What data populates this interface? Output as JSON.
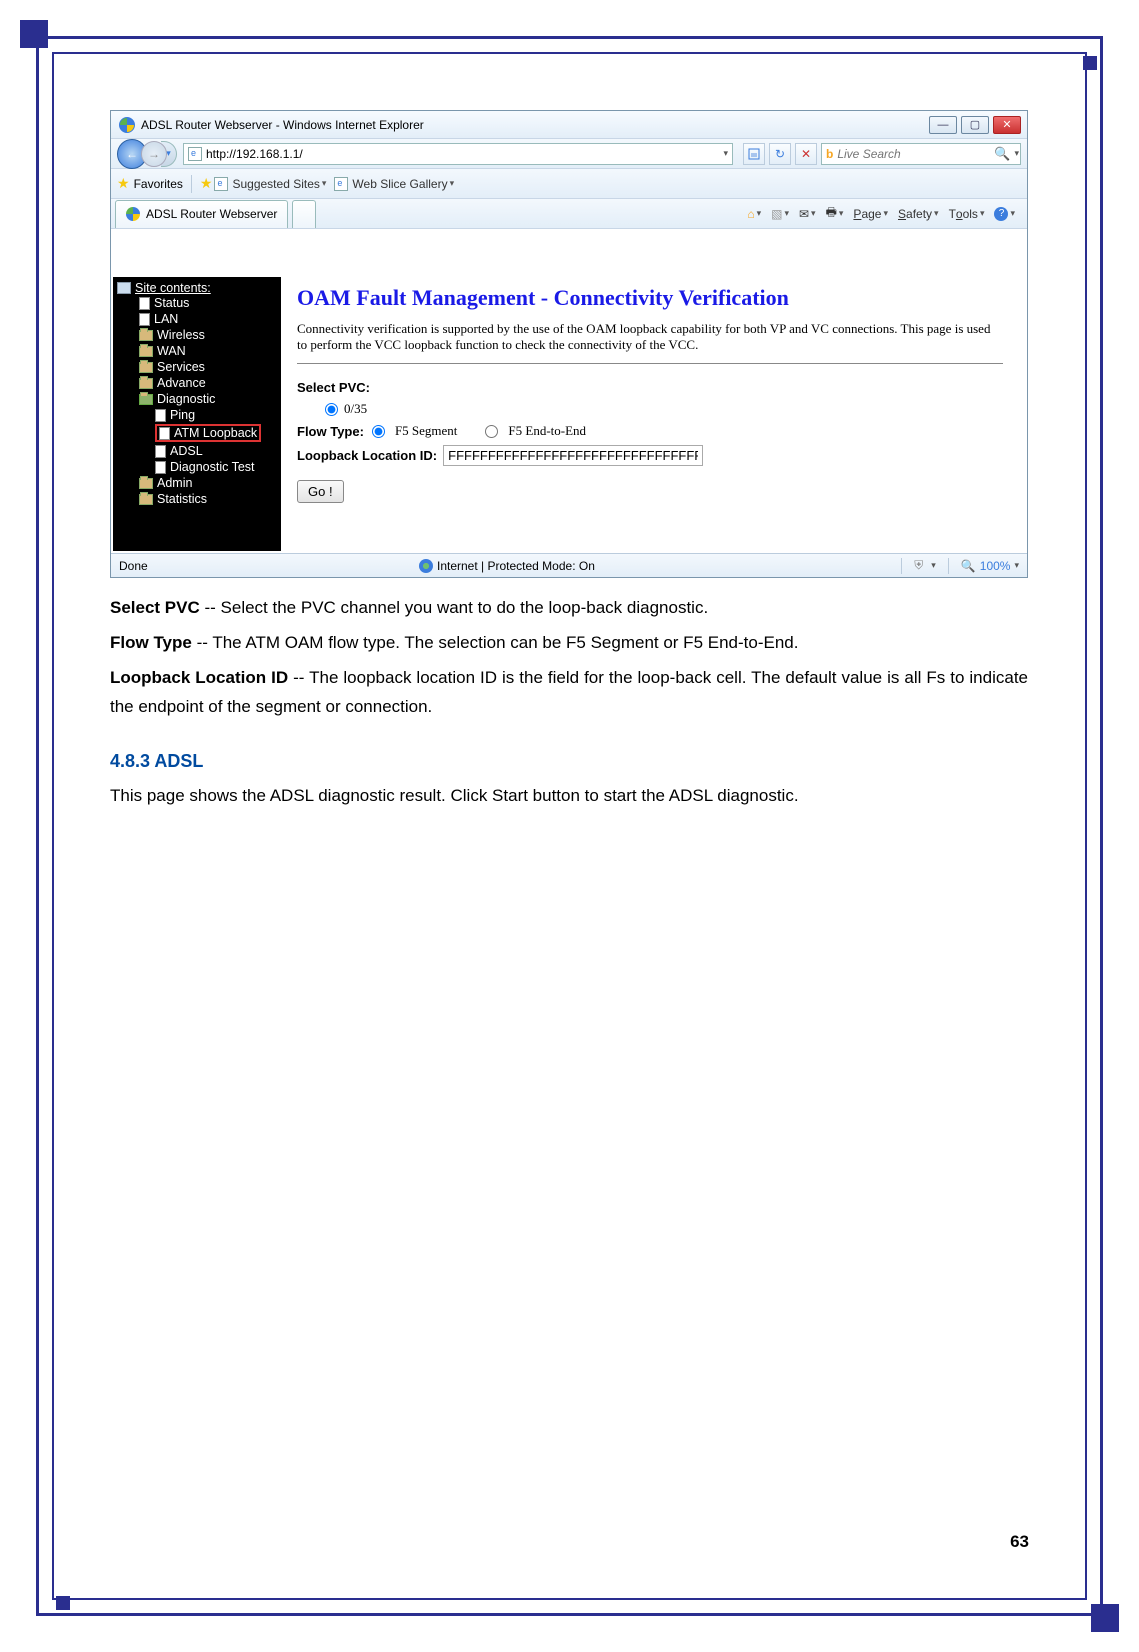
{
  "window": {
    "title": "ADSL Router Webserver - Windows Internet Explorer",
    "address": "http://192.168.1.1/",
    "search_placeholder": "Live Search",
    "favorites_label": "Favorites",
    "suggested_sites": "Suggested Sites",
    "web_slice": "Web Slice Gallery",
    "tab_title": "ADSL Router Webserver",
    "menu": {
      "page": "Page",
      "safety": "Safety",
      "tools": "Tools"
    },
    "status_left": "Done",
    "status_center": "Internet | Protected Mode: On",
    "zoom": "100%"
  },
  "sidebar": {
    "header": "Site contents:",
    "items": {
      "status": "Status",
      "lan": "LAN",
      "wireless": "Wireless",
      "wan": "WAN",
      "services": "Services",
      "advance": "Advance",
      "diagnostic": "Diagnostic",
      "ping": "Ping",
      "atm_loopback": "ATM Loopback",
      "adsl": "ADSL",
      "diag_test": "Diagnostic Test",
      "admin": "Admin",
      "statistics": "Statistics"
    }
  },
  "main": {
    "heading": "OAM Fault Management - Connectivity Verification",
    "description": "Connectivity verification is supported by the use of the OAM loopback capability for both VP and VC connections. This page is used to perform the VCC loopback function to check the connectivity of the VCC.",
    "select_pvc_label": "Select PVC:",
    "pvc_option": "0/35",
    "flow_type_label": "Flow Type:",
    "flow_opt1": "F5 Segment",
    "flow_opt2": "F5 End-to-End",
    "loopback_label": "Loopback Location ID:",
    "loopback_value": "FFFFFFFFFFFFFFFFFFFFFFFFFFFFFFFF",
    "go_button": "Go !"
  },
  "doc": {
    "p1": {
      "term": "Select PVC",
      "text": " -- Select the PVC channel you want to do the loop-back diagnostic."
    },
    "p2": {
      "term": "Flow Type",
      "text": " -- The ATM OAM flow type. The selection can be F5 Segment or F5 End-to-End."
    },
    "p3": {
      "term": "Loopback Location ID",
      "text": " -- The loopback location ID is the field for the loop-back cell. The default value is all Fs to indicate the endpoint of the segment or connection."
    },
    "section": "4.8.3 ADSL",
    "section_text": "This page shows the ADSL diagnostic result. Click Start button to start the ADSL diagnostic."
  },
  "page_number": "63"
}
